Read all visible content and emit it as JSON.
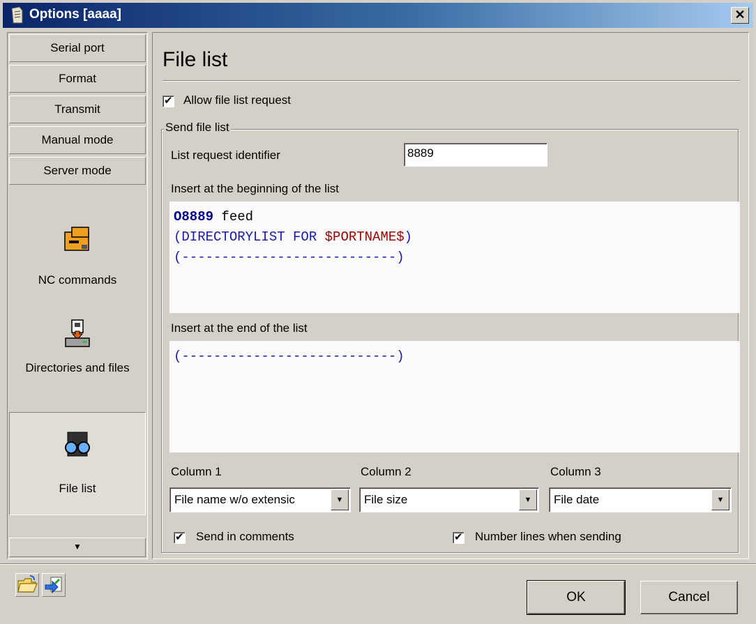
{
  "window": {
    "title": "Options [aaaa]",
    "close_label": "✕"
  },
  "sidebar": {
    "tabs": [
      "Serial port",
      "Format",
      "Transmit",
      "Manual mode",
      "Server mode"
    ],
    "items": [
      {
        "label": "NC commands",
        "icon": "nc-commands-icon"
      },
      {
        "label": "Directories and files",
        "icon": "directories-icon"
      },
      {
        "label": "File list",
        "icon": "file-list-icon",
        "selected": true
      }
    ],
    "scroll_down": "▼"
  },
  "main": {
    "title": "File list",
    "allow_request_label": "Allow file list request",
    "allow_request_checked": true,
    "group_label": "Send file list",
    "identifier_label": "List request identifier",
    "identifier_value": "8889",
    "begin_label": "Insert at the beginning of the list",
    "begin_lines": {
      "l1_code": "O8889",
      "l1_rest": " feed",
      "l2_a": "(DIRECTORYLIST FOR ",
      "l2_var": "$PORTNAME$",
      "l2_b": ")",
      "l3": "(---------------------------)"
    },
    "end_label": "Insert at the end of the list",
    "end_lines": {
      "l1": "(---------------------------)"
    },
    "columns": [
      {
        "label": "Column 1",
        "value": "File name w/o extensic"
      },
      {
        "label": "Column 2",
        "value": "File size"
      },
      {
        "label": "Column 3",
        "value": "File date"
      }
    ],
    "send_comments_label": "Send in comments",
    "send_comments_checked": true,
    "number_lines_label": "Number lines when sending",
    "number_lines_checked": true
  },
  "footer": {
    "ok_label": "OK",
    "cancel_label": "Cancel"
  }
}
